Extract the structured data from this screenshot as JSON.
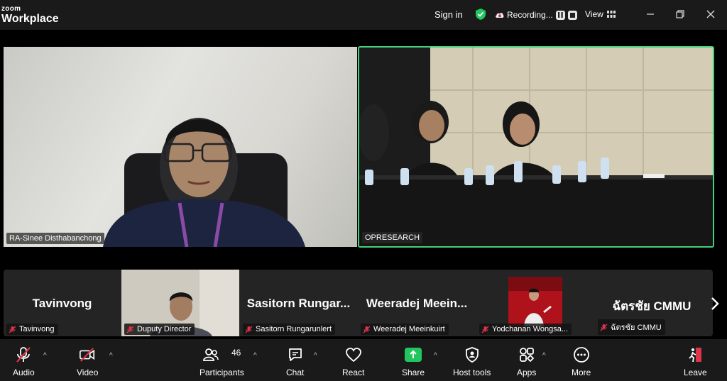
{
  "app": {
    "brand_top": "zoom",
    "brand_bottom": "Workplace"
  },
  "titlebar": {
    "signin": "Sign in",
    "recording": "Recording...",
    "view": "View"
  },
  "main": {
    "tile1_name": "RA-Sinee Disthabanchong",
    "tile2_name": "OPRESEARCH",
    "active_speaker_color": "#43d17a"
  },
  "gallery": {
    "tiles": [
      {
        "display": "Tavinvong",
        "label": "Tavinvong"
      },
      {
        "display": "",
        "label": "Duputy Director"
      },
      {
        "display": "Sasitorn  Rungar...",
        "label": "Sasitorn Rungarunlert"
      },
      {
        "display": "Weeradej  Meein...",
        "label": "Weeradej Meeinkuirt"
      },
      {
        "display": "",
        "label": "Yodchanan Wongsa..."
      },
      {
        "display": "ฉัตรชัย CMMU",
        "label": "ฉัตรชัย CMMU"
      }
    ]
  },
  "toolbar": {
    "audio": "Audio",
    "video": "Video",
    "participants": "Participants",
    "participants_count": "46",
    "chat": "Chat",
    "react": "React",
    "share": "Share",
    "host_tools": "Host tools",
    "apps": "Apps",
    "more": "More",
    "leave": "Leave",
    "share_color": "#22c55e",
    "muted_color": "#e0334a"
  }
}
